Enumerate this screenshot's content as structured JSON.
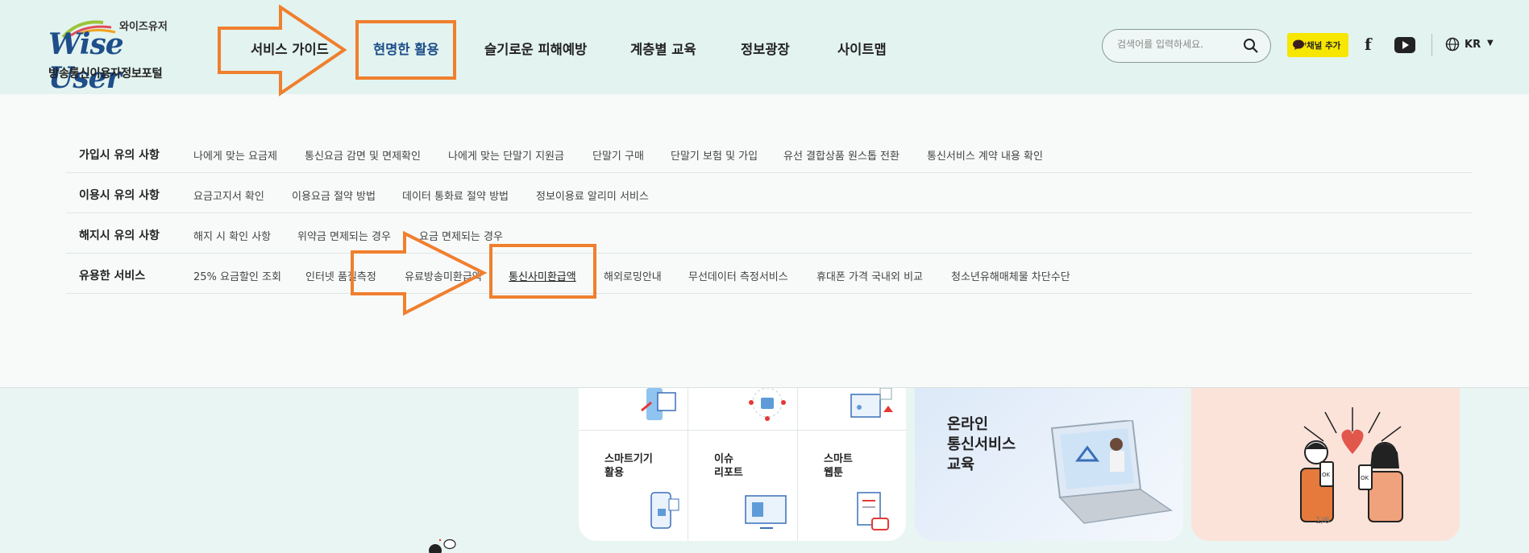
{
  "logo": {
    "ko_top": "와이즈유저",
    "brand": "Wise User",
    "sub": "방송통신이용자정보포털"
  },
  "nav": [
    {
      "label": "서비스 가이드"
    },
    {
      "label": "현명한 활용"
    },
    {
      "label": "슬기로운 피해예방"
    },
    {
      "label": "계층별 교육"
    },
    {
      "label": "정보광장"
    },
    {
      "label": "사이트맵"
    }
  ],
  "search": {
    "placeholder": "검색어를 입력하세요."
  },
  "kakao": {
    "label": "채널 추가"
  },
  "facebook": {
    "label": "f"
  },
  "lang": {
    "label": "KR",
    "caret": "▼"
  },
  "dropdown": {
    "rows": [
      {
        "category": "가입시 유의 사항",
        "items": [
          "나에게 맞는 요금제",
          "통신요금 감면 및 면제확인",
          "나에게 맞는 단말기 지원금",
          "단말기 구매",
          "단말기 보험 및 가입",
          "유선 결합상품 원스톱 전환",
          "통신서비스 계약 내용 확인"
        ]
      },
      {
        "category": "이용시 유의 사항",
        "items": [
          "요금고지서 확인",
          "이용요금 절약 방법",
          "데이터 통화료 절약 방법",
          "정보이용료 알리미 서비스"
        ]
      },
      {
        "category": "해지시 유의 사항",
        "items": [
          "해지 시 확인 사항",
          "위약금 면제되는 경우",
          "요금 면제되는 경우"
        ]
      },
      {
        "category": "유용한 서비스",
        "items": [
          "25% 요금할인 조회",
          "인터넷 품질측정",
          "유료방송미환급액",
          "통신사미환급액",
          "해외로밍안내",
          "무선데이터 측정서비스",
          "휴대폰 가격 국내외 비교",
          "청소년유해매체물 차단수단"
        ]
      }
    ]
  },
  "cards": {
    "grid": [
      {
        "label": "스마트기기\n활용"
      },
      {
        "label": "이슈\n리포트"
      },
      {
        "label": "스마트\n웹툰"
      }
    ],
    "edu": {
      "title_1": "온라인",
      "title_2": "통신서비스",
      "title_3": "교육"
    },
    "page_num": "1/6"
  },
  "colors": {
    "accent": "#f07f2e",
    "brand": "#1e4f8a",
    "header_bg": "#e3f3ef",
    "kakao": "#f7e600"
  }
}
